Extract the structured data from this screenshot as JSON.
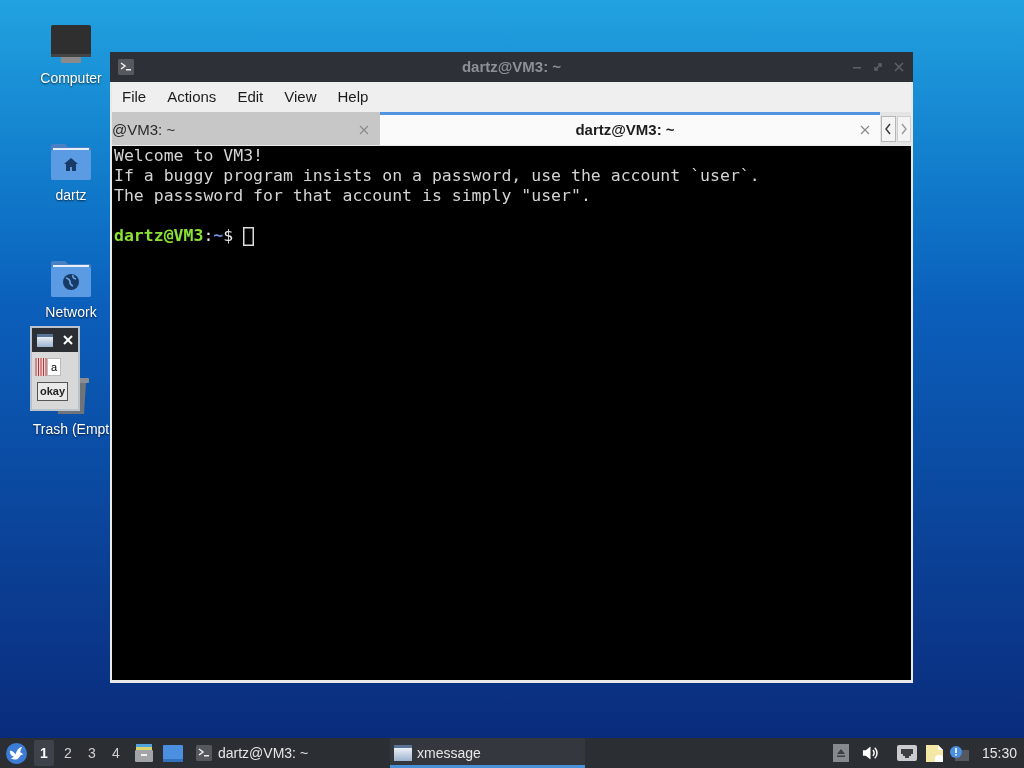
{
  "desktop": {
    "icons": [
      {
        "kind": "computer",
        "label": "Computer"
      },
      {
        "kind": "home",
        "label": "dartz"
      },
      {
        "kind": "network",
        "label": "Network"
      },
      {
        "kind": "trash",
        "label": "Trash (Empt"
      }
    ]
  },
  "xmessage_window": {
    "message": "a",
    "button": "okay"
  },
  "terminal_window": {
    "title": "dartz@VM3: ~",
    "menu": [
      "File",
      "Actions",
      "Edit",
      "View",
      "Help"
    ],
    "tabs": [
      {
        "label": "@VM3: ~",
        "selected": false
      },
      {
        "label": "dartz@VM3: ~",
        "selected": true
      }
    ],
    "output": [
      "Welcome to VM3!",
      "If a buggy program insists on a password, use the account `user`.",
      "The passsword for that account is simply \"user\"."
    ],
    "prompt": {
      "user_host": "dartz@VM3",
      "separator": ":",
      "path": "~",
      "symbol": "$"
    }
  },
  "taskbar": {
    "workspaces": [
      {
        "label": "1",
        "selected": true
      },
      {
        "label": "2",
        "selected": false
      },
      {
        "label": "3",
        "selected": false
      },
      {
        "label": "4",
        "selected": false
      }
    ],
    "tasks": [
      {
        "kind": "terminal",
        "label": "dartz@VM3: ~",
        "selected": false
      },
      {
        "kind": "window",
        "label": "xmessage",
        "selected": true
      }
    ],
    "clock": "15:30"
  }
}
